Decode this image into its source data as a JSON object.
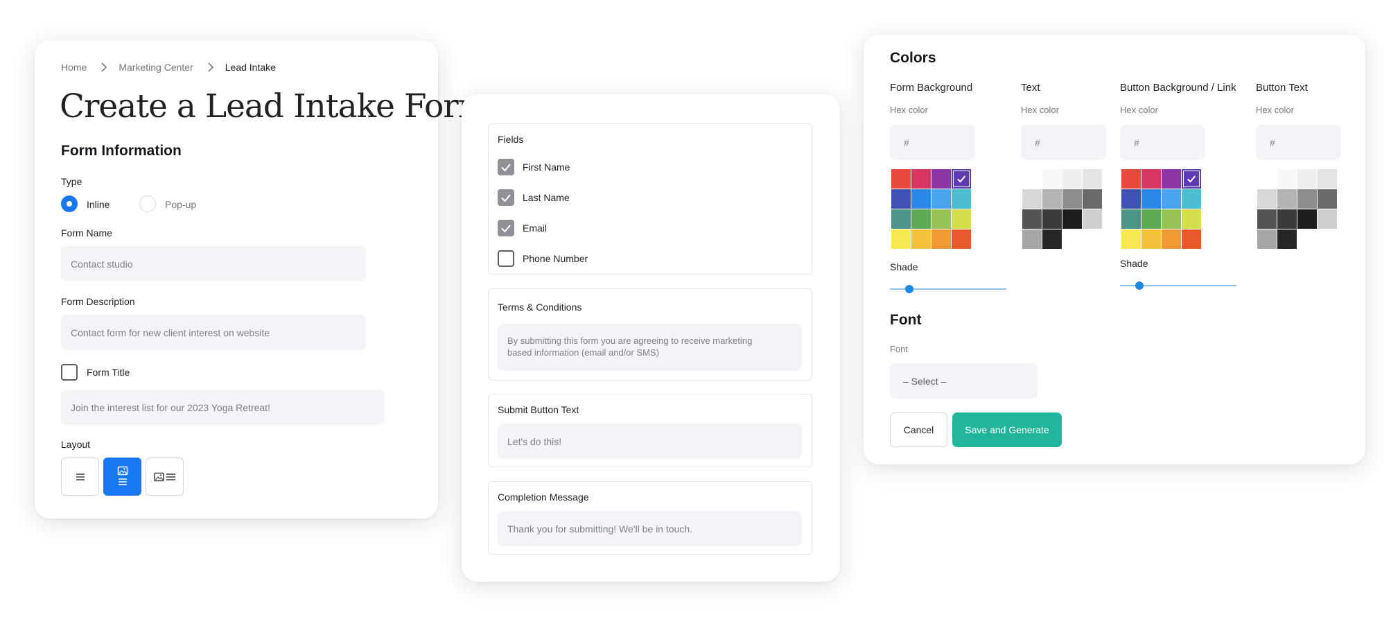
{
  "breadcrumb": [
    "Home",
    "Marketing Center",
    "Lead Intake"
  ],
  "page_title": "Create a Lead Intake Form",
  "form_info": {
    "heading": "Form Information",
    "type_label": "Type",
    "type_options": [
      "Inline",
      "Pop-up"
    ],
    "type_selected": "Inline",
    "name_label": "Form Name",
    "name_value": "Contact studio",
    "desc_label": "Form Description",
    "desc_value": "Contact form for new client interest on website",
    "title_checkbox_label": "Form Title",
    "title_checked": false,
    "title_value": "Join the interest list for our 2023 Yoga Retreat!",
    "layout_label": "Layout",
    "layout_options": [
      "text-only-icon",
      "image-above-text-icon",
      "image-beside-text-icon"
    ],
    "layout_selected": 1
  },
  "fields": {
    "heading": "Fields",
    "items": [
      {
        "label": "First Name",
        "checked": true
      },
      {
        "label": "Last Name",
        "checked": true
      },
      {
        "label": "Email",
        "checked": true
      },
      {
        "label": "Phone Number",
        "checked": false
      }
    ]
  },
  "terms": {
    "heading": "Terms & Conditions",
    "line1": "By submitting this form you are agreeing to receive marketing",
    "line2": "based information (email and/or SMS)"
  },
  "submit": {
    "heading": "Submit Button Text",
    "value": "Let's do this!"
  },
  "completion": {
    "heading": "Completion Message",
    "value": "Thank you for submitting! We'll be in touch."
  },
  "colors": {
    "heading": "Colors",
    "hex_label": "Hex color",
    "hex_placeholder": "#",
    "shade_label": "Shade",
    "columns": [
      {
        "label": "Form Background",
        "palette": "color",
        "has_shade": true
      },
      {
        "label": "Text",
        "palette": "gray",
        "has_shade": false
      },
      {
        "label": "Button Background / Link",
        "palette": "color",
        "has_shade": true
      },
      {
        "label": "Button Text",
        "palette": "gray",
        "has_shade": false
      }
    ],
    "color_swatches": [
      "#e6493b",
      "#d63664",
      "#8e36a6",
      "#5e3bb2",
      "#3f51b5",
      "#2c88e8",
      "#4aa3ee",
      "#4bbfcf",
      "#4a9587",
      "#5fab55",
      "#96c354",
      "#d4de4c",
      "#f8e84f",
      "#f4c239",
      "#ef9a33",
      "#e9592c"
    ],
    "gray_swatches": [
      "#ffffff",
      "#f8f8f8",
      "#efefef",
      "#e4e4e4",
      "#d8d8d8",
      "#b4b4b4",
      "#8e8e8e",
      "#6a6a6a",
      "#545454",
      "#3a3a3a",
      "#1e1e1e",
      "#cfcfcf",
      "#a6a6a6",
      "#262626",
      "#ffffff",
      "#ffffff"
    ],
    "selected_color_index": 3
  },
  "font": {
    "heading": "Font",
    "label": "Font",
    "select_value": "– Select –"
  },
  "actions": {
    "cancel": "Cancel",
    "save": "Save and Generate"
  }
}
